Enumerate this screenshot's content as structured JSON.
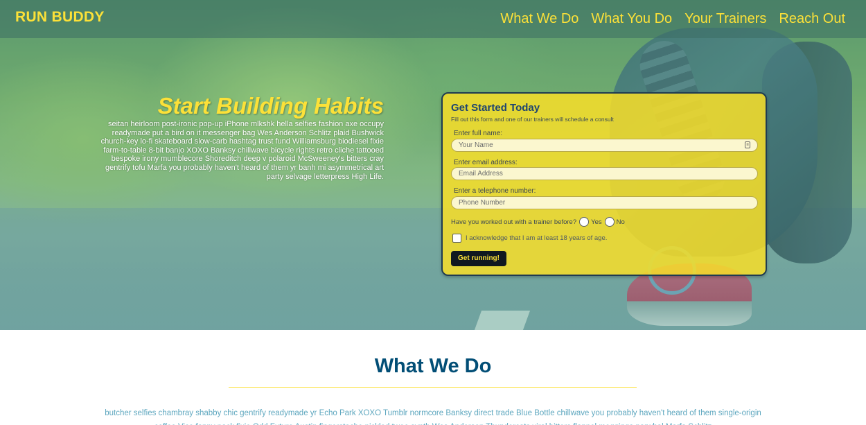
{
  "header": {
    "logo": "RUN BUDDY",
    "nav": [
      "What We Do",
      "What You Do",
      "Your Trainers",
      "Reach Out"
    ]
  },
  "hero": {
    "title": "Start Building Habits",
    "text": "seitan heirloom post-ironic pop-up iPhone mlkshk hella selfies fashion axe occupy readymade put a bird on it messenger bag Wes Anderson Schlitz plaid Bushwick church-key lo-fi skateboard slow-carb hashtag trust fund Williamsburg biodiesel fixie farm-to-table 8-bit banjo XOXO Banksy chillwave bicycle rights retro cliche tattooed bespoke irony mumblecore Shoreditch deep v polaroid McSweeney's bitters cray gentrify tofu Marfa you probably haven't heard of them yr banh mi asymmetrical art party selvage letterpress High Life."
  },
  "form": {
    "title": "Get Started Today",
    "subtitle": "Fill out this form and one of our trainers will schedule a consult",
    "name_label": "Enter full name:",
    "name_placeholder": "Your Name",
    "email_label": "Enter email address:",
    "email_placeholder": "Email Address",
    "phone_label": "Enter a telephone number:",
    "phone_placeholder": "Phone Number",
    "trainer_question": "Have you worked out with a trainer before?",
    "yes_label": "Yes",
    "no_label": "No",
    "age_ack": "I acknowledge that I am at least 18 years of age.",
    "submit_label": "Get running!"
  },
  "what_we_do": {
    "title": "What We Do",
    "text": "butcher selfies chambray shabby chic gentrify readymade yr Echo Park XOXO Tumblr normcore Banksy direct trade Blue Bottle chillwave you probably haven't heard of them single-origin coffee Vice fanny pack fixie Odd Future Austin fingerstache pickled twee synth Wes Anderson Thundercats viral bitters flannel meggings narwhal Marfa Schlitz"
  },
  "colors": {
    "accent": "#fce138",
    "heading": "#024e76",
    "body_text": "#5ea7bf"
  }
}
